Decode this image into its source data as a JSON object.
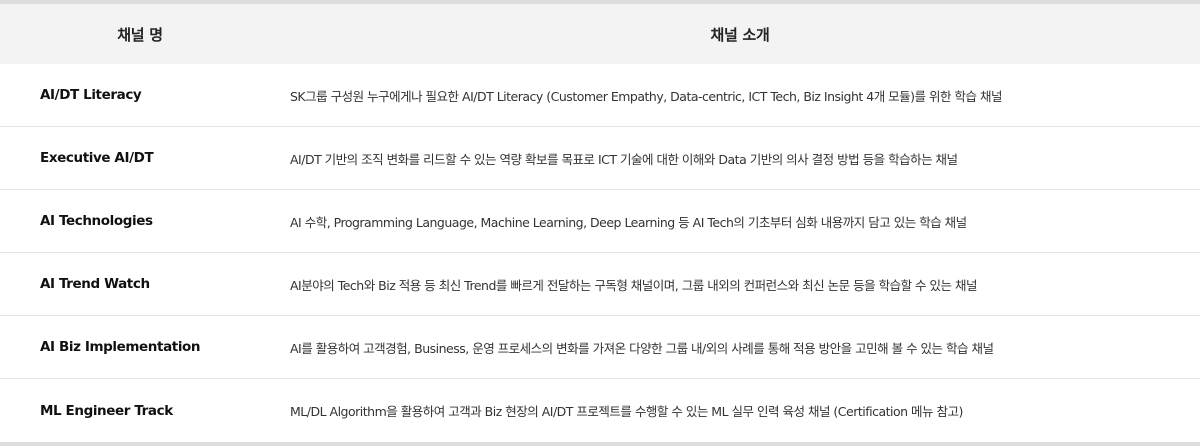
{
  "header": {
    "col_name": "채널 명",
    "col_desc": "채널 소개"
  },
  "rows": [
    {
      "name": "AI/DT Literacy",
      "desc": "SK그룹 구성원 누구에게나 필요한 AI/DT Literacy (Customer Empathy, Data-centric, ICT Tech, Biz Insight 4개 모듈)를 위한 학습 채널"
    },
    {
      "name": "Executive AI/DT",
      "desc": "AI/DT 기반의 조직 변화를 리드할 수 있는 역량 확보를 목표로 ICT 기술에 대한 이해와 Data 기반의 의사 결정 방법 등을 학습하는 채널"
    },
    {
      "name": "AI Technologies",
      "desc": "AI 수학, Programming Language, Machine Learning, Deep Learning 등 AI Tech의 기초부터 심화 내용까지 담고 있는 학습 채널"
    },
    {
      "name": "AI Trend Watch",
      "desc": "AI분야의 Tech와 Biz 적용 등 최신 Trend를 빠르게 전달하는 구독형 채널이며, 그룹 내외의 컨퍼런스와 최신 논문 등을 학습할 수 있는 채널"
    },
    {
      "name": "AI Biz Implementation",
      "desc": "AI를 활용하여 고객경험, Business, 운영 프로세스의 변화를 가져온 다양한 그룹 내/외의 사례를 통해 적용 방안을 고민해 볼 수 있는 학습 채널"
    },
    {
      "name": "ML Engineer Track",
      "desc": "ML/DL Algorithm을 활용하여 고객과 Biz 현장의 AI/DT 프로젝트를 수행할 수 있는 ML 실무 인력 육성 채널 (Certification 메뉴 참고)"
    }
  ]
}
